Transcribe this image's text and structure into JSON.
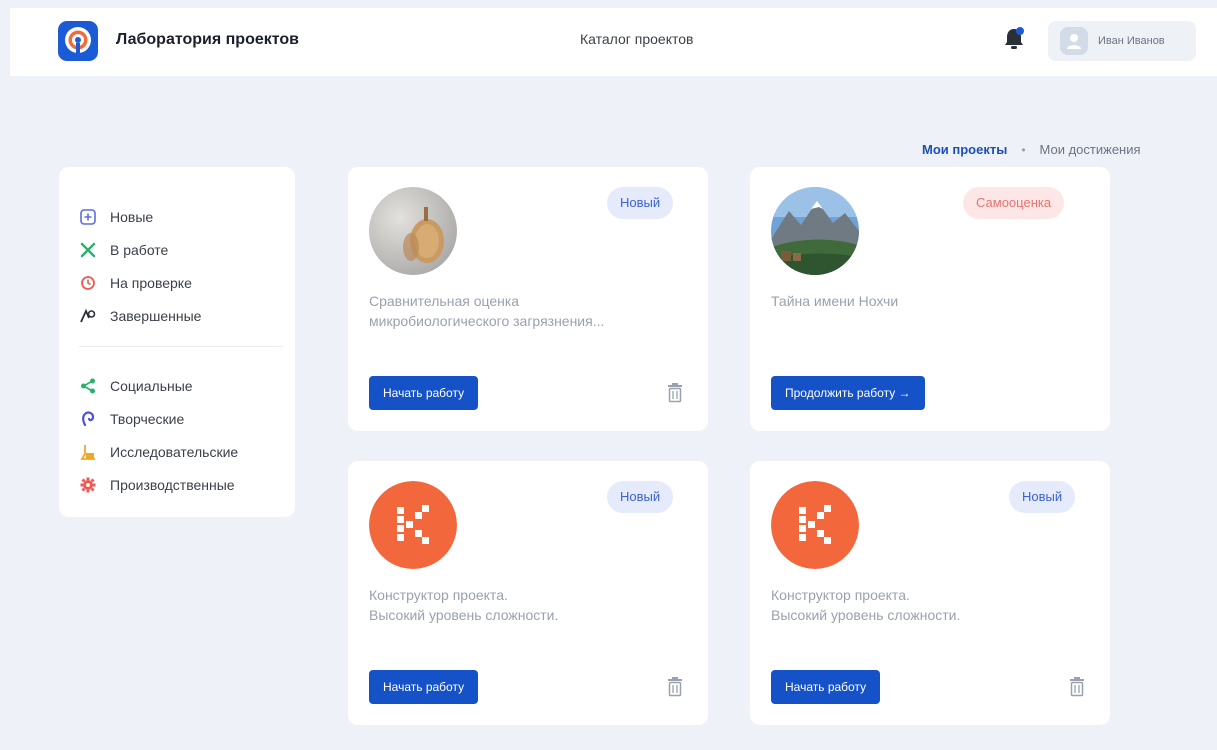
{
  "header": {
    "brand": "Лаборатория проектов",
    "catalog": "Каталог проектов",
    "user_name": "Иван Иванов",
    "icons": [
      "logo-icon",
      "bell-icon",
      "avatar-icon"
    ]
  },
  "tabs": {
    "active": "Мои проекты",
    "separator": "•",
    "other": "Мои достижения"
  },
  "sidebar": {
    "status_items": [
      {
        "label": "Новые",
        "icon": "new-icon",
        "color": "#5a6ee0"
      },
      {
        "label": "В работе",
        "icon": "in-work-icon",
        "color": "#27b36a"
      },
      {
        "label": "На проверке",
        "icon": "review-icon",
        "color": "#f0574f"
      },
      {
        "label": "Завершенные",
        "icon": "finished-icon",
        "color": "#2b2f38"
      }
    ],
    "type_items": [
      {
        "label": "Социальные",
        "icon": "share-icon",
        "color": "#27b36a"
      },
      {
        "label": "Творческие",
        "icon": "creative-icon",
        "color": "#4c4fe0"
      },
      {
        "label": "Исследовательские",
        "icon": "flask-icon",
        "color": "#f0a629"
      },
      {
        "label": "Производственные",
        "icon": "gear-icon",
        "color": "#f0574f"
      }
    ]
  },
  "cards": [
    {
      "badge": "Новый",
      "desc_line1": "Сравнительная оценка",
      "desc_line2": "микробиологического загрязнения...",
      "button": "Начать работу"
    },
    {
      "badge": "Самооценка",
      "desc_line1": "Тайна имени Нохчи",
      "desc_line2": "",
      "button": "Продолжить работу"
    },
    {
      "badge": "Новый",
      "desc_line1": "Конструктор проекта.",
      "desc_line2": "Высокий уровень сложности.",
      "button": "Начать работу"
    },
    {
      "badge": "Новый",
      "desc_line1": "Конструктор проекта.",
      "desc_line2": "Высокий уровень сложности.",
      "button": "Начать работу"
    }
  ],
  "colors": {
    "accent": "#1552c8",
    "background": "#eef2f8",
    "badge_new": "#e6ebfb",
    "badge_self": "#fde7e6",
    "constructor_logo": "#f2673c"
  }
}
